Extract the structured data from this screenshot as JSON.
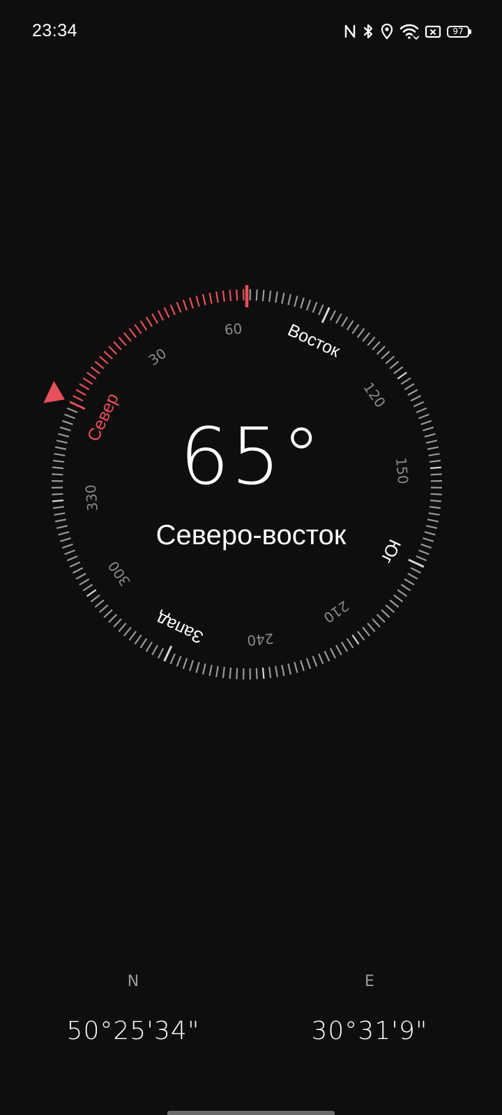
{
  "status_bar": {
    "time": "23:34",
    "icons": [
      "nfc-icon",
      "bluetooth-icon",
      "location-icon",
      "wifi-icon",
      "no-sim-icon",
      "battery-icon"
    ],
    "battery": "97"
  },
  "compass": {
    "heading_value": "65°",
    "direction_name": "Северо-восток",
    "heading_degrees": 65,
    "cardinals": {
      "north": "Север",
      "east": "Восток",
      "south": "Юг",
      "west": "Запад"
    },
    "degree_labels": [
      "30",
      "60",
      "120",
      "150",
      "210",
      "240",
      "300",
      "330"
    ],
    "north_color": "#e8505b",
    "tick_color": "#9a9a9a",
    "marker_color": "#e8505b"
  },
  "coordinates": {
    "latitude_label": "N",
    "latitude_value": "50°25'34\"",
    "longitude_label": "E",
    "longitude_value": "30°31'9\""
  }
}
